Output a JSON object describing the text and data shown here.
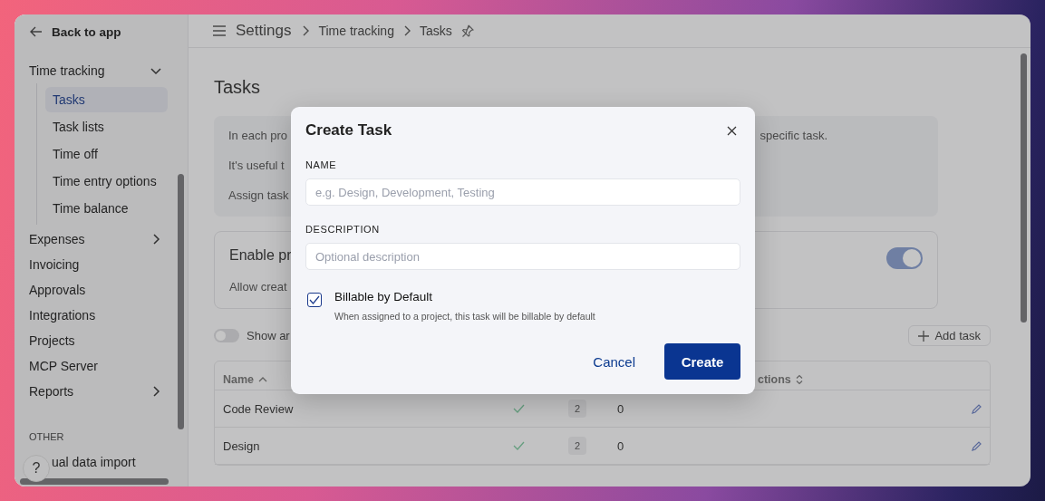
{
  "sidebar": {
    "back_link": "Back to app",
    "sections": [
      {
        "items": [
          {
            "label": "Time tracking",
            "kind": "group",
            "expanded": true,
            "selected": false,
            "children": [
              {
                "label": "Tasks",
                "selected": true
              },
              {
                "label": "Task lists",
                "selected": false
              },
              {
                "label": "Time off",
                "selected": false
              },
              {
                "label": "Time entry options",
                "selected": false
              },
              {
                "label": "Time balance",
                "selected": false
              }
            ]
          },
          {
            "label": "Expenses",
            "kind": "group",
            "expanded": false,
            "selected": false
          },
          {
            "label": "Invoicing",
            "kind": "link",
            "selected": false
          },
          {
            "label": "Approvals",
            "kind": "link",
            "selected": false
          },
          {
            "label": "Integrations",
            "kind": "link",
            "selected": false
          },
          {
            "label": "Projects",
            "kind": "link",
            "selected": false
          },
          {
            "label": "MCP Server",
            "kind": "link",
            "selected": false
          },
          {
            "label": "Reports",
            "kind": "group",
            "expanded": false,
            "selected": false
          }
        ]
      },
      {
        "heading": "OTHER",
        "items": [
          {
            "label": "ual data import",
            "kind": "link",
            "selected": false
          }
        ]
      }
    ],
    "help_button": "?"
  },
  "breadcrumb": [
    "Settings",
    "Time tracking",
    "Tasks"
  ],
  "page_title": "Tasks",
  "info": {
    "lines": [
      [
        "In each pro",
        "specific task."
      ],
      [
        "It's useful t"
      ],
      [
        "Assign task"
      ]
    ]
  },
  "setting_card": {
    "title": "Enable pr",
    "description": "Allow creat",
    "on": true
  },
  "show_archived": {
    "label": "Show ar",
    "on": false
  },
  "add_button": "Add task",
  "table": {
    "columns": [
      {
        "label": "Name",
        "sorted": true
      },
      {
        "label": "ctions",
        "sorted": false
      }
    ],
    "rows": [
      {
        "name": "Code Review",
        "billable": true,
        "projects": "2",
        "rates": "0"
      },
      {
        "name": "Design",
        "billable": true,
        "projects": "2",
        "rates": "0"
      }
    ]
  },
  "dialog": {
    "title": "Create Task",
    "fields": [
      {
        "label": "NAME",
        "placeholder": "e.g. Design, Development, Testing"
      },
      {
        "label": "DESCRIPTION",
        "placeholder": "Optional description"
      }
    ],
    "checkbox": {
      "label": "Billable by Default",
      "hint": "When assigned to a project, this task will be billable by default",
      "checked": true
    },
    "cancel": "Cancel",
    "confirm": "Create"
  }
}
